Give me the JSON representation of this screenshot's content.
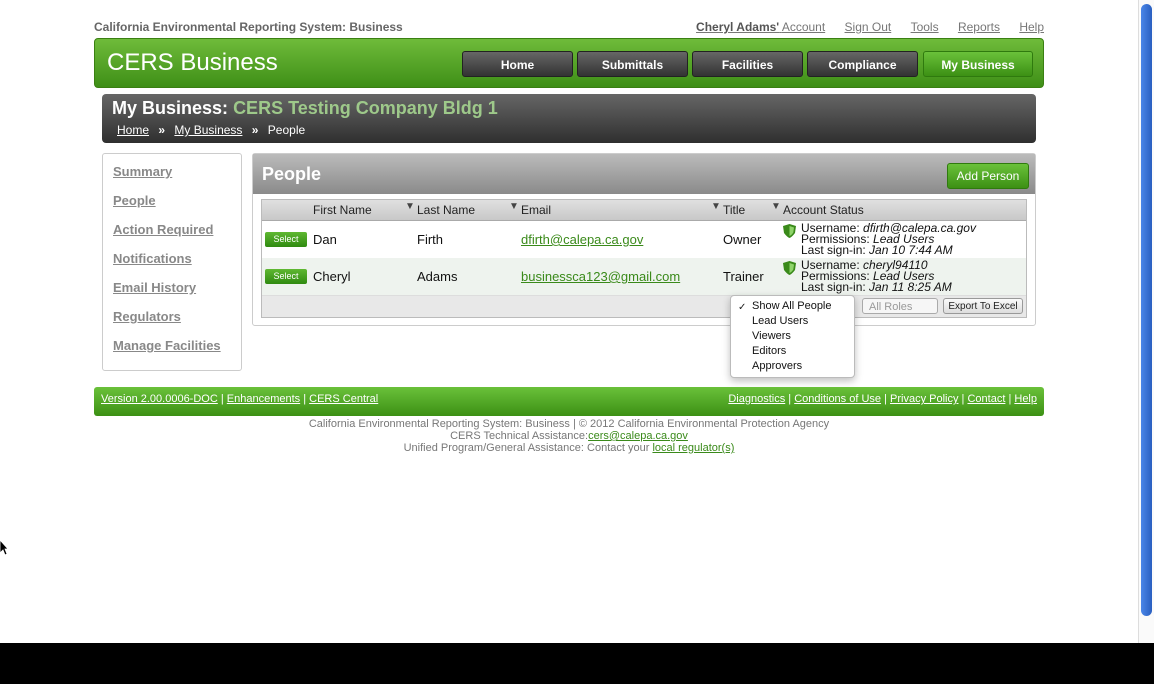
{
  "top": {
    "site_title": "California Environmental Reporting System: Business",
    "user_name": "Cheryl Adams'",
    "account": "Account",
    "sign_out": "Sign Out",
    "tools": "Tools",
    "reports": "Reports",
    "help": "Help"
  },
  "header": {
    "logo": "CERS Business",
    "nav": [
      {
        "label": "Home"
      },
      {
        "label": "Submittals"
      },
      {
        "label": "Facilities"
      },
      {
        "label": "Compliance"
      },
      {
        "label": "My Business"
      }
    ]
  },
  "business": {
    "prefix": "My Business:",
    "name": "CERS Testing Company Bldg 1",
    "crumbs": [
      "Home",
      "My Business",
      "People"
    ],
    "sep": "»"
  },
  "sidebar": {
    "items": [
      {
        "label": "Summary"
      },
      {
        "label": "People"
      },
      {
        "label": "Action Required"
      },
      {
        "label": "Notifications"
      },
      {
        "label": "Email History"
      },
      {
        "label": "Regulators"
      },
      {
        "label": "Manage Facilities"
      }
    ]
  },
  "panel": {
    "title": "People",
    "add_button": "Add Person"
  },
  "grid": {
    "columns": [
      "First Name",
      "Last Name",
      "Email",
      "Title",
      "Account Status"
    ],
    "select_label": "Select",
    "rows": [
      {
        "first": "Dan",
        "last": "Firth",
        "email": "dfirth@calepa.ca.gov",
        "title": "Owner",
        "username_label": "Username:",
        "username": "dfirth@calepa.ca.gov",
        "perm_label": "Permissions:",
        "perm": "Lead Users",
        "signin_label": "Last sign-in:",
        "signin": "Jan 10 7:44 AM"
      },
      {
        "first": "Cheryl",
        "last": "Adams",
        "email": "businessca123@gmail.com",
        "title": "Trainer",
        "username_label": "Username:",
        "username": "cheryl94110",
        "perm_label": "Permissions:",
        "perm": "Lead Users",
        "signin_label": "Last sign-in:",
        "signin": "Jan 11 8:25 AM"
      }
    ],
    "roles_select": "All Roles",
    "export_button": "Export To Excel"
  },
  "dropdown": {
    "check": "✓",
    "options": [
      "Show All People",
      "Lead Users",
      "Viewers",
      "Editors",
      "Approvers"
    ]
  },
  "footer": {
    "version": "Version 2.00.0006-DOC",
    "enhancements": "Enhancements",
    "central": "CERS Central",
    "diagnostics": "Diagnostics",
    "conditions": "Conditions of Use",
    "privacy": "Privacy Policy",
    "contact": "Contact",
    "help": "Help",
    "sep": "|"
  },
  "legal": {
    "line1": "California Environmental Reporting System: Business | © 2012 California Environmental Protection Agency",
    "line2_prefix": "CERS Technical Assistance:",
    "line2_email": "cers@calepa.ca.gov",
    "line3_prefix": "Unified Program/General Assistance: Contact your ",
    "line3_link": "local regulator(s)"
  },
  "colors": {
    "brand_green": "#4fa323",
    "dark_bar": "#333333",
    "link_green": "#3a8a1a"
  }
}
